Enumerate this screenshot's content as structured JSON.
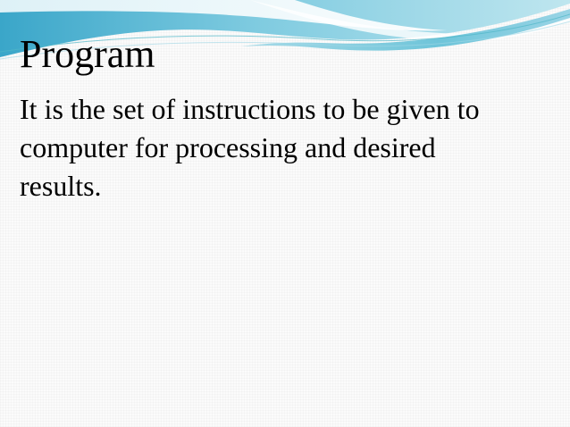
{
  "slide": {
    "title": "Program",
    "body": "It is the set of instructions to be given to computer for processing and desired results."
  },
  "colors": {
    "background": "#fbfbfb",
    "swoosh_light": "#dff1f6",
    "swoosh_mid": "#8fd0e3",
    "swoosh_dark": "#3aa6c9",
    "swoosh_teal": "#4fb7c8",
    "text": "#000000"
  }
}
